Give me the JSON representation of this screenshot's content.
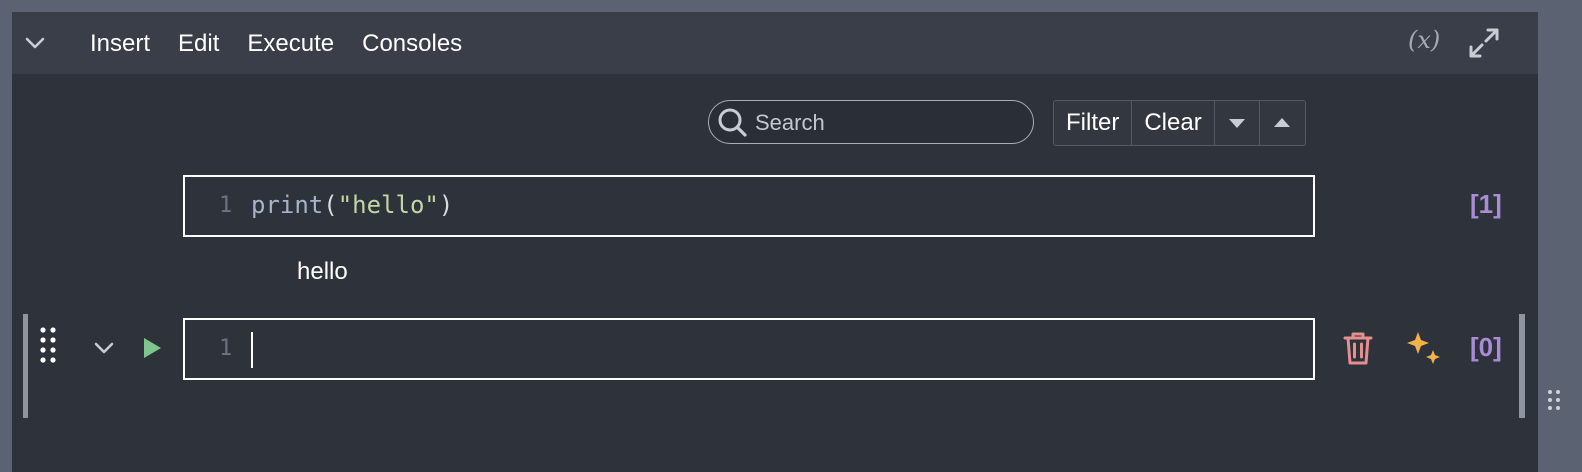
{
  "toolbar": {
    "menu": [
      "Insert",
      "Edit",
      "Execute",
      "Consoles"
    ],
    "variables_label": "(x)"
  },
  "search": {
    "placeholder": "Search",
    "value": ""
  },
  "filter_buttons": {
    "filter": "Filter",
    "clear": "Clear"
  },
  "cells": [
    {
      "line_number": "1",
      "code": {
        "fn": "print",
        "open": "(",
        "str": "\"hello\"",
        "close": ")"
      },
      "execution_count": "[1]",
      "output": "hello"
    },
    {
      "line_number": "1",
      "code": "",
      "execution_count": "[0]"
    }
  ],
  "icons": {
    "collapse": "chevron-down-icon",
    "expand": "expand-icon",
    "search": "search-icon",
    "sort_down": "triangle-down-icon",
    "sort_up": "triangle-up-icon",
    "drag": "drag-handle-icon",
    "run": "play-icon",
    "delete": "trash-icon",
    "ai": "sparkles-icon"
  },
  "colors": {
    "accent_exec": "#a98bd6",
    "run_green": "#7fc58e",
    "delete_red": "#e58f8f",
    "ai_orange": "#f2b14a"
  }
}
